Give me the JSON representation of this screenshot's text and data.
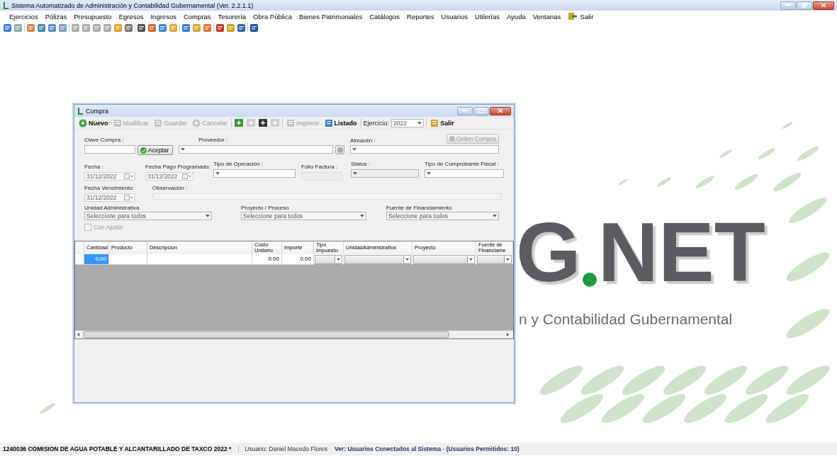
{
  "window": {
    "title": "Sistema Automatizado de Administración y Contabilidad Gubernamental  (Ver. 2.2.1.1)"
  },
  "menu": [
    {
      "kind": "text",
      "label": "Ejercicios"
    },
    {
      "kind": "text",
      "label": "Pólizas"
    },
    {
      "kind": "text",
      "label": "Presupuesto"
    },
    {
      "kind": "text",
      "label": "Egresos"
    },
    {
      "kind": "text",
      "label": "Ingresos"
    },
    {
      "kind": "text",
      "label": "Compras"
    },
    {
      "kind": "text",
      "label": "Tesorería"
    },
    {
      "kind": "text",
      "label": "Obra Pública"
    },
    {
      "kind": "text",
      "label": "Bienes Patrimoniales"
    },
    {
      "kind": "text",
      "label": "Catálogos"
    },
    {
      "kind": "text",
      "label": "Reportes"
    },
    {
      "kind": "text",
      "label": "Usuarios"
    },
    {
      "kind": "text",
      "label": "Utilerías"
    },
    {
      "kind": "text",
      "label": "Ayuda"
    },
    {
      "kind": "text",
      "label": "Ventanas"
    },
    {
      "kind": "exit",
      "label": "Salir"
    }
  ],
  "background_logo": {
    "mark_left": "G",
    "mark_right": "NET",
    "subtitle": "n y Contabilidad Gubernamental"
  },
  "dialog": {
    "title": "Compra",
    "toolbar": [
      {
        "kind": "button",
        "label": "Nuevo",
        "disabled": false
      },
      {
        "kind": "button",
        "label": "Modificar",
        "disabled": true
      },
      {
        "kind": "button",
        "label": "Guardar",
        "disabled": true
      },
      {
        "kind": "button",
        "label": "Cancelar",
        "disabled": true
      },
      {
        "kind": "icon",
        "disabled": false
      },
      {
        "kind": "icon",
        "disabled": true
      },
      {
        "kind": "icon",
        "disabled": false
      },
      {
        "kind": "icon",
        "disabled": true
      },
      {
        "kind": "button",
        "label": "Imprimir",
        "disabled": true
      },
      {
        "kind": "button",
        "label": "Listado",
        "disabled": false
      },
      {
        "kind": "combo",
        "label": "Ejercicio:",
        "value": "2022"
      },
      {
        "kind": "button",
        "label": "Salir",
        "disabled": false
      }
    ],
    "clave_compra": {
      "label": "Clave Compra :",
      "button": "Aceptar"
    },
    "proveedor": {
      "label": "Proveedor :"
    },
    "almacen": {
      "label": "Almacén :",
      "button": "Orden Compra",
      "button_disabled": true
    },
    "fecha": {
      "label": "Fecha :",
      "value": "31/12/2022"
    },
    "fecha_pago": {
      "label": "Fecha Pago Programado:",
      "value": "31/12/2022"
    },
    "tipo_operacion": {
      "label": "Tipo de Operación :",
      "disabled": false
    },
    "folio_factura": {
      "label": "Folio Factura :",
      "disabled": true
    },
    "status": {
      "label": "Status :",
      "disabled": true
    },
    "tipo_comprobante": {
      "label": "Tipo de Comprobante Fiscal :",
      "disabled": false
    },
    "fecha_vencimiento": {
      "label": "Fecha Vencimiento:",
      "value": "31/12/2022"
    },
    "observacion": {
      "label": "Observación :"
    },
    "unidad_administrativa": {
      "label": "Unidad Administrativa",
      "value": "Seleccione para todos"
    },
    "proyecto": {
      "label": "Proyecto / Proceso",
      "value": "Seleccione para todos"
    },
    "fuente": {
      "label": "Fuente de Financiamiento",
      "value": "Seleccione para todos"
    },
    "con_ajuste": {
      "label": "Con Ajuste",
      "checked": false,
      "disabled": true
    },
    "table": {
      "columns": [
        "Cantidad",
        "Producto",
        "Descripcion",
        "Costo Unitario",
        "Importe",
        "Tipo Impuesto",
        "UnidadAdministrativa",
        "Proyecto",
        "Fuente de Financiame"
      ],
      "rows": [
        {
          "cells": [
            {
              "kind": "text",
              "value": "0.00",
              "selected": true
            },
            {
              "kind": "text",
              "selected": false
            },
            {
              "kind": "text",
              "selected": false
            },
            {
              "kind": "text",
              "value": "0.00",
              "selected": false
            },
            {
              "kind": "text",
              "value": "0.00",
              "selected": false
            },
            {
              "kind": "combo",
              "selected": false
            },
            {
              "kind": "combo",
              "selected": false
            },
            {
              "kind": "combo",
              "selected": false
            },
            {
              "kind": "combo",
              "selected": false
            }
          ]
        }
      ]
    }
  },
  "status_bar": {
    "entity": "1240036 COMISION DE AGUA POTABLE Y ALCANTARILLADO DE TAXCO  2022  *",
    "user": "Usuario: Daniel Macedo Flores",
    "users_link": "**Ver: Usuarios Conectados al Sistema** - **(Usuarios Permitidos: 10)**"
  }
}
